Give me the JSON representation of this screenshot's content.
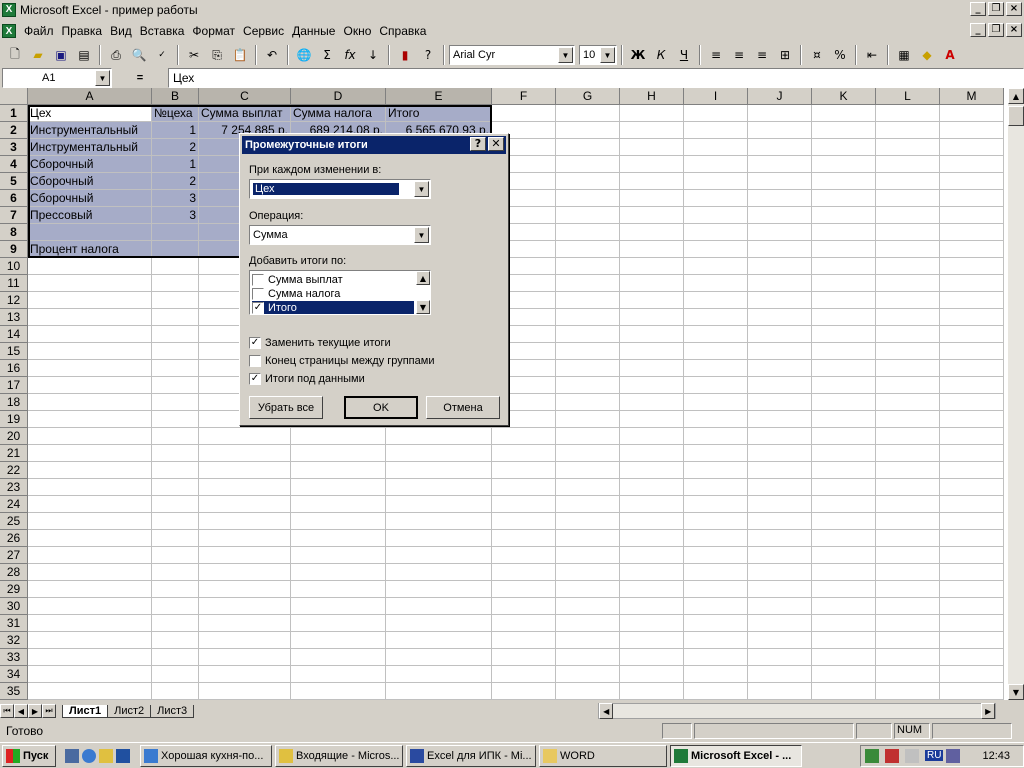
{
  "window": {
    "title": "Microsoft Excel - пример работы"
  },
  "menu": [
    "Файл",
    "Правка",
    "Вид",
    "Вставка",
    "Формат",
    "Сервис",
    "Данные",
    "Окно",
    "Справка"
  ],
  "toolbar": {
    "font": "Arial Cyr",
    "size": "10"
  },
  "formula": {
    "cellref": "A1",
    "eq": "=",
    "value": "Цех"
  },
  "columns": [
    "A",
    "B",
    "C",
    "D",
    "E",
    "F",
    "G",
    "H",
    "I",
    "J",
    "K",
    "L",
    "M"
  ],
  "rows": [
    [
      "Цех",
      "№цеха",
      "Сумма выплат",
      "Сумма налога",
      "Итого"
    ],
    [
      "Инструментальный",
      "1",
      "7 254 885 р.",
      "689 214,08 р.",
      "6 565 670,93 р."
    ],
    [
      "Инструментальный",
      "2",
      "7 25",
      "",
      " "
    ],
    [
      "Сборочный",
      "1",
      "1 35",
      "",
      ""
    ],
    [
      "Сборочный",
      "2",
      "1 35",
      "",
      ""
    ],
    [
      "Сборочный",
      "3",
      "1 35",
      "",
      ""
    ],
    [
      "Прессовый",
      "3",
      "5 48",
      "",
      ""
    ],
    [
      "",
      "",
      "14 07",
      "",
      ""
    ],
    [
      "Процент налога",
      "",
      "",
      "",
      ""
    ]
  ],
  "sheets": [
    "Лист1",
    "Лист2",
    "Лист3"
  ],
  "status": {
    "ready": "Готово",
    "num": "NUM"
  },
  "dialog": {
    "title": "Промежуточные итоги",
    "help_btn": "?",
    "close_btn": "✕",
    "change_label": "При каждом изменении в:",
    "change_value": "Цех",
    "op_label": "Операция:",
    "op_value": "Сумма",
    "add_label": "Добавить итоги по:",
    "list": [
      {
        "label": "Сумма выплат",
        "checked": false
      },
      {
        "label": "Сумма налога",
        "checked": false
      },
      {
        "label": "Итого",
        "checked": true
      }
    ],
    "replace": "Заменить текущие итоги",
    "pagebreak": "Конец страницы между группами",
    "below": "Итоги под данными",
    "remove_all": "Убрать все",
    "ok": "OK",
    "cancel": "Отмена"
  },
  "taskbar": {
    "start": "Пуск",
    "items": [
      "Хорошая кухня-по...",
      "Входящие - Micros...",
      "Excel для ИПК - Mi...",
      "WORD",
      "Microsoft Excel - ..."
    ],
    "lang": "RU",
    "clock": "12:43"
  },
  "colors": {
    "title": "#0a246a",
    "selection": "#a6acc8",
    "face": "#d4d0c8"
  }
}
